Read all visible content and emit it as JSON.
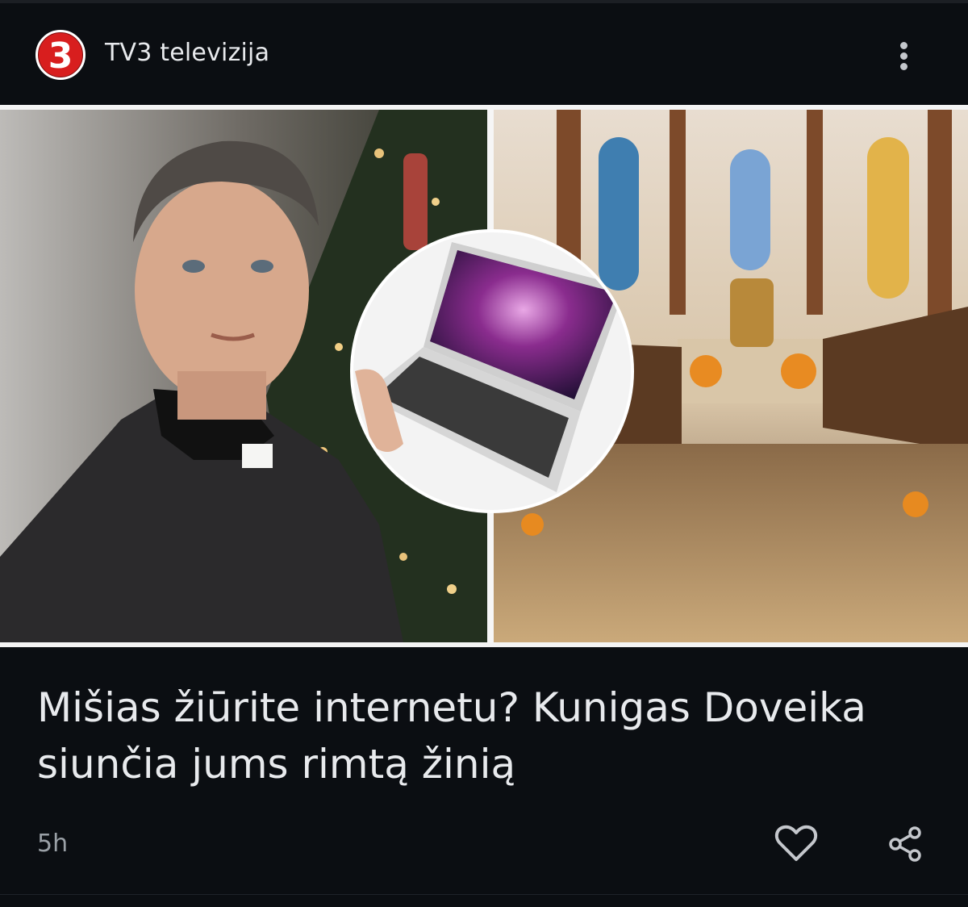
{
  "source": {
    "name": "TV3 televizija",
    "logo_glyph": "3",
    "logo_color": "#d81e1e"
  },
  "header": {
    "more_icon": "more-vert-icon"
  },
  "article": {
    "image_alt": "",
    "headline": "Mišias žiūrite internetu? Kunigas Doveika siunčia jums rimtą žinią",
    "timestamp": "5h"
  },
  "actions": {
    "like_icon": "heart-icon",
    "share_icon": "share-icon"
  },
  "colors": {
    "background": "#0b0e12",
    "text": "#e8eaed",
    "muted": "#9aa0a6"
  }
}
